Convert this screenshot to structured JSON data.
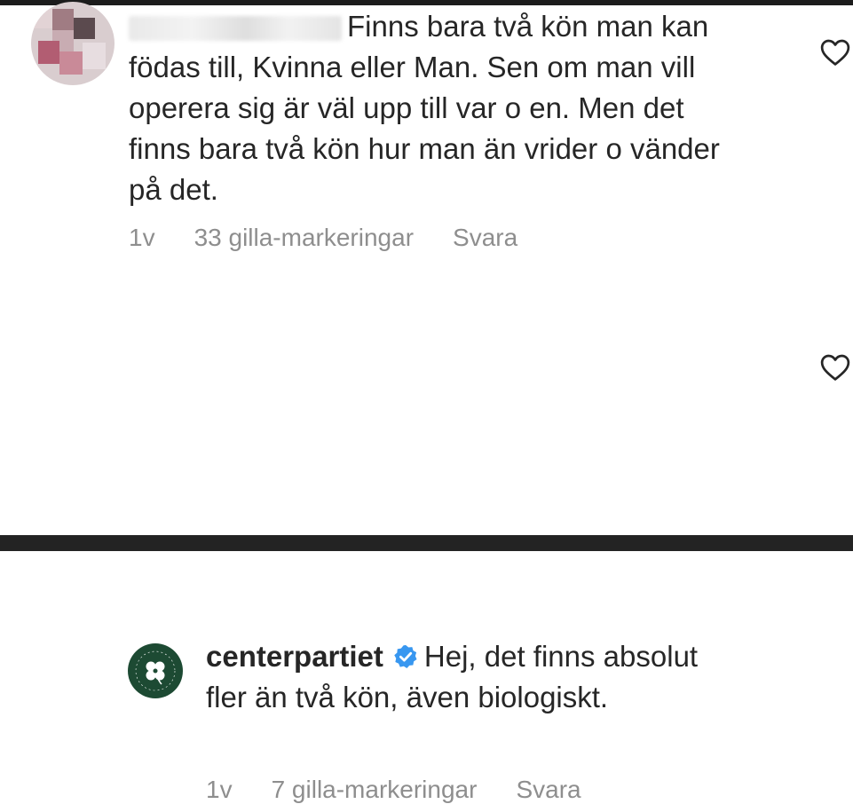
{
  "comments": [
    {
      "username": "",
      "text": "Finns bara två kön man kan födas till, Kvinna eller Man. Sen om man vill operera sig är väl upp till var o en. Men det finns bara två kön hur man än vrider o vänder på det.",
      "time": "1v",
      "likes": "33 gilla-markeringar",
      "reply": "Svara",
      "verified": false
    },
    {
      "username": "centerpartiet",
      "text": "Hej, det finns absolut fler än två kön, även biologiskt.",
      "time": "1v",
      "likes": "7 gilla-markeringar",
      "reply": "Svara",
      "verified": true
    }
  ],
  "colors": {
    "text": "#262626",
    "meta": "#8e8e8e",
    "verified": "#3897f0",
    "avatar_bg": "#1d4a33"
  },
  "icons": {
    "like": "heart-outline-icon",
    "verified": "verified-badge-icon",
    "avatar_logo": "clover-icon"
  }
}
